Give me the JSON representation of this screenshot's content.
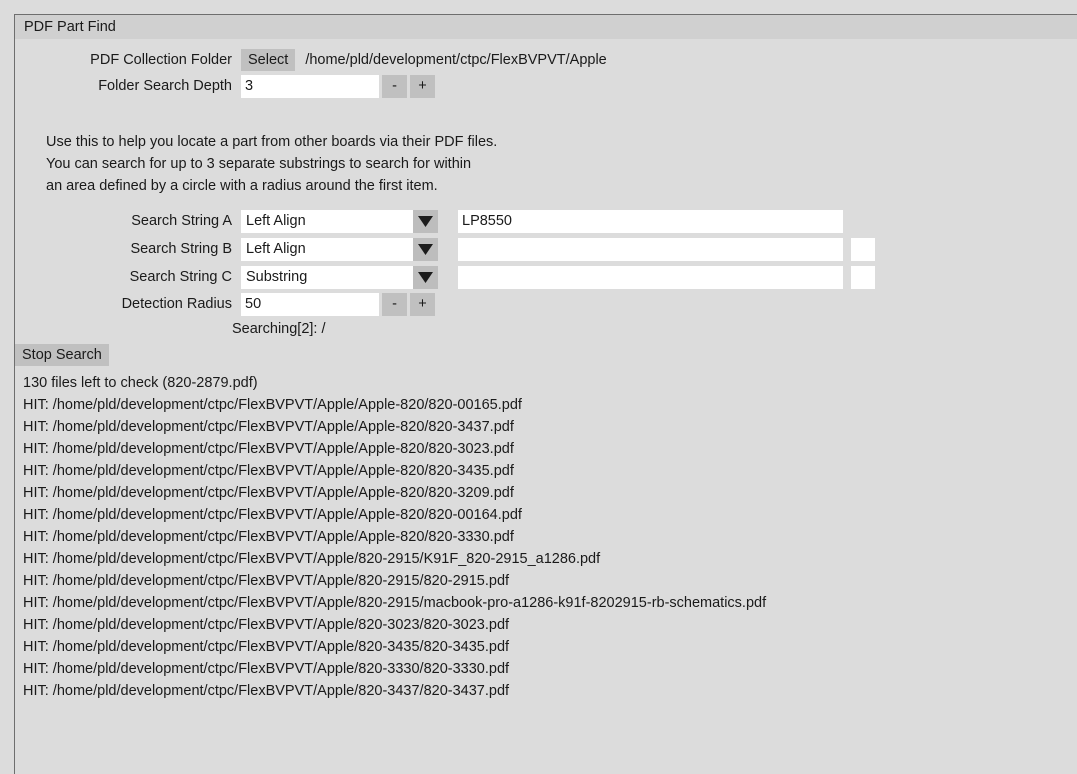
{
  "window": {
    "title": "PDF Part Find"
  },
  "collection": {
    "label": "PDF Collection Folder",
    "select_button": "Select",
    "path": "/home/pld/development/ctpc/FlexBVPVT/Apple"
  },
  "depth": {
    "label": "Folder Search Depth",
    "value": "3",
    "minus": "-",
    "plus": "+"
  },
  "help": {
    "line1": "Use this to help you locate a part from other boards via their PDF files.",
    "line2": "You can search for up to 3 separate substrings to search for within",
    "line3": "an area defined by a circle with a radius around the first item."
  },
  "search_rows": [
    {
      "label": "Search String A",
      "mode": "Left Align",
      "value": "LP8550",
      "has_extra_box": false
    },
    {
      "label": "Search String B",
      "mode": "Left Align",
      "value": "",
      "has_extra_box": true
    },
    {
      "label": "Search String C",
      "mode": "Substring",
      "value": "",
      "has_extra_box": true
    }
  ],
  "radius": {
    "label": "Detection Radius",
    "value": "50",
    "minus": "-",
    "plus": "+"
  },
  "status": {
    "searching": "Searching[2]: /",
    "stop_button": "Stop Search"
  },
  "log": {
    "lines": [
      "130 files left to check (820-2879.pdf)",
      "HIT: /home/pld/development/ctpc/FlexBVPVT/Apple/Apple-820/820-00165.pdf",
      "HIT: /home/pld/development/ctpc/FlexBVPVT/Apple/Apple-820/820-3437.pdf",
      "HIT: /home/pld/development/ctpc/FlexBVPVT/Apple/Apple-820/820-3023.pdf",
      "HIT: /home/pld/development/ctpc/FlexBVPVT/Apple/Apple-820/820-3435.pdf",
      "HIT: /home/pld/development/ctpc/FlexBVPVT/Apple/Apple-820/820-3209.pdf",
      "HIT: /home/pld/development/ctpc/FlexBVPVT/Apple/Apple-820/820-00164.pdf",
      "HIT: /home/pld/development/ctpc/FlexBVPVT/Apple/Apple-820/820-3330.pdf",
      "HIT: /home/pld/development/ctpc/FlexBVPVT/Apple/820-2915/K91F_820-2915_a1286.pdf",
      "HIT: /home/pld/development/ctpc/FlexBVPVT/Apple/820-2915/820-2915.pdf",
      "HIT: /home/pld/development/ctpc/FlexBVPVT/Apple/820-2915/macbook-pro-a1286-k91f-8202915-rb-schematics.pdf",
      "HIT: /home/pld/development/ctpc/FlexBVPVT/Apple/820-3023/820-3023.pdf",
      "HIT: /home/pld/development/ctpc/FlexBVPVT/Apple/820-3435/820-3435.pdf",
      "HIT: /home/pld/development/ctpc/FlexBVPVT/Apple/820-3330/820-3330.pdf",
      "HIT: /home/pld/development/ctpc/FlexBVPVT/Apple/820-3437/820-3437.pdf"
    ]
  },
  "colors": {
    "window_bg": "#dcdcdc",
    "titlebar_bg": "#d0d0d0",
    "button_bg": "#c0c0c0",
    "input_bg": "#ffffff",
    "border": "#6e6e6e",
    "text": "#1a1a1a"
  }
}
